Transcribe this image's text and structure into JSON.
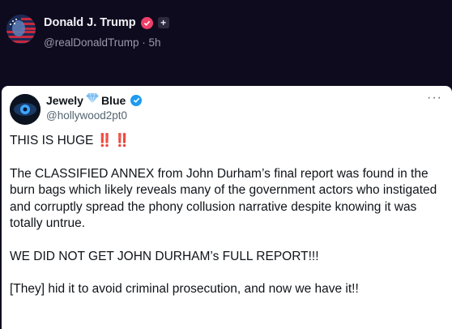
{
  "post": {
    "author_name": "Donald J. Trump",
    "handle": "@realDonaldTrump",
    "separator": "·",
    "time": "5h",
    "plus_label": "+"
  },
  "quoted": {
    "name_first": "Jewely",
    "name_last": "Blue",
    "handle": "@hollywood2pt0",
    "more_label": "···",
    "headline": "THIS IS HUGE",
    "headline_emoji": "‼️ ‼️",
    "paragraphs": [
      "The CLASSIFIED ANNEX from John Durham’s final report was found in the burn bags which likely reveals many of the government actors who instigated and corruptly spread the phony collusion narrative despite knowing it was totally untrue.",
      "WE DID NOT GET JOHN DURHAM’s FULL REPORT!!!",
      "[They] hid it to avoid criminal prosecution, and now we have it!!"
    ]
  },
  "colors": {
    "background": "#0e0b1f",
    "verified_red": "#ee3f69",
    "verified_blue": "#1d9bf0",
    "emoji_red": "#e0162b"
  },
  "icons": {
    "diamond": "blue-diamond-icon",
    "check": "check-icon"
  }
}
